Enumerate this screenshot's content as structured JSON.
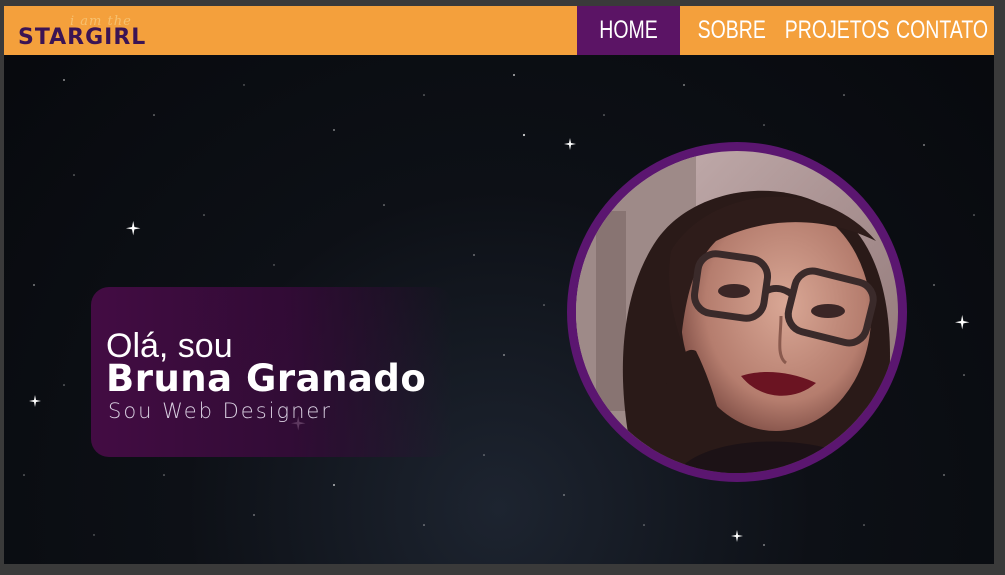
{
  "brand": {
    "script_text": "i am the",
    "logo_text": "STARGIRL"
  },
  "nav": {
    "items": [
      {
        "label": "HOME",
        "active": true
      },
      {
        "label": "SOBRE",
        "active": false
      },
      {
        "label": "PROJETOS",
        "active": false
      },
      {
        "label": "CONTATO",
        "active": false
      }
    ]
  },
  "hero": {
    "greeting": "Olá, sou",
    "name": "Bruna Granado",
    "role": "Sou Web Designer"
  },
  "colors": {
    "topbar": "#f4a03c",
    "nav_active": "#5b1465",
    "logo": "#3b1454",
    "photo_ring": "#5b1670",
    "background": "#0b0e13"
  }
}
